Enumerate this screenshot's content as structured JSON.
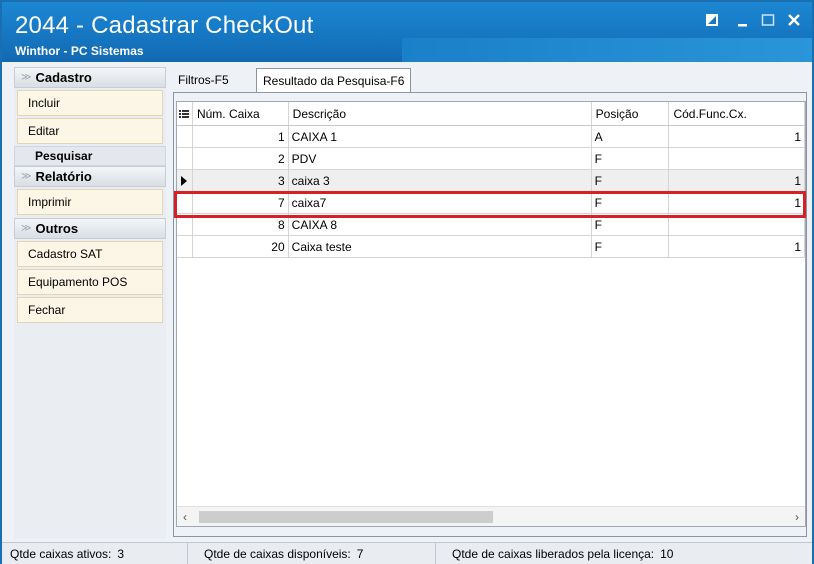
{
  "window": {
    "title": "2044 - Cadastrar CheckOut",
    "subtitle": "Winthor - PC Sistemas",
    "colors": {
      "titlebar": "#1677c2",
      "highlight": "#d81f26",
      "button_bg": "#fbf6e6"
    }
  },
  "sidebar": {
    "cadastro_header": "Cadastro",
    "incluir": "Incluir",
    "editar": "Editar",
    "pesquisar": "Pesquisar",
    "relatorio_header": "Relatório",
    "imprimir": "Imprimir",
    "outros_header": "Outros",
    "cadastro_sat": "Cadastro SAT",
    "equipamento_pos": "Equipamento POS",
    "fechar": "Fechar"
  },
  "tabs": {
    "filtros": "Filtros-F5",
    "resultado": "Resultado da Pesquisa-F6"
  },
  "grid": {
    "columns": [
      "Núm. Caixa",
      "Descrição",
      "Posição",
      "Cód.Func.Cx."
    ],
    "rows": [
      {
        "num": "1",
        "desc": "CAIXA 1",
        "pos": "A",
        "cod": "1"
      },
      {
        "num": "2",
        "desc": "PDV",
        "pos": "F",
        "cod": ""
      },
      {
        "num": "3",
        "desc": "caixa 3",
        "pos": "F",
        "cod": "1"
      },
      {
        "num": "7",
        "desc": "caixa7",
        "pos": "F",
        "cod": "1"
      },
      {
        "num": "8",
        "desc": "CAIXA 8",
        "pos": "F",
        "cod": ""
      },
      {
        "num": "20",
        "desc": "Caixa teste",
        "pos": "F",
        "cod": "1"
      }
    ],
    "selected_row": 2
  },
  "status": {
    "ativos_label": "Qtde caixas ativos:",
    "ativos_value": "3",
    "disponiveis_label": "Qtde de caixas disponíveis:",
    "disponiveis_value": "7",
    "liberados_label": "Qtde de caixas liberados pela licença:",
    "liberados_value": "10"
  }
}
